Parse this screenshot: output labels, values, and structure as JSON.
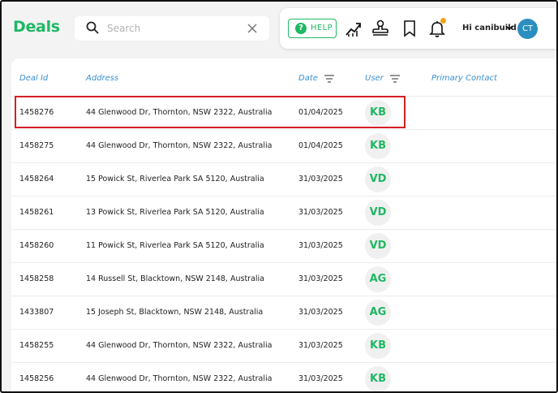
{
  "page_title": "Deals",
  "search": {
    "placeholder": "Search"
  },
  "header": {
    "help_label": "HELP",
    "greeting": "Hi canibuild",
    "avatar_initials": "CT"
  },
  "table": {
    "columns": {
      "deal_id": "Deal Id",
      "address": "Address",
      "date": "Date",
      "user": "User",
      "primary_contact": "Primary Contact"
    },
    "rows": [
      {
        "deal_id": "1458276",
        "address": "44 Glenwood Dr, Thornton, NSW 2322, Australia",
        "date": "01/04/2025",
        "user": "KB"
      },
      {
        "deal_id": "1458275",
        "address": "44 Glenwood Dr, Thornton, NSW 2322, Australia",
        "date": "01/04/2025",
        "user": "KB"
      },
      {
        "deal_id": "1458264",
        "address": "15 Powick St, Riverlea Park SA 5120, Australia",
        "date": "31/03/2025",
        "user": "VD"
      },
      {
        "deal_id": "1458261",
        "address": "13 Powick St, Riverlea Park SA 5120, Australia",
        "date": "31/03/2025",
        "user": "VD"
      },
      {
        "deal_id": "1458260",
        "address": "11 Powick St, Riverlea Park SA 5120, Australia",
        "date": "31/03/2025",
        "user": "VD"
      },
      {
        "deal_id": "1458258",
        "address": "14 Russell St, Blacktown, NSW 2148, Australia",
        "date": "31/03/2025",
        "user": "AG"
      },
      {
        "deal_id": "1433807",
        "address": "15 Joseph St, Blacktown, NSW 2148, Australia",
        "date": "31/03/2025",
        "user": "AG"
      },
      {
        "deal_id": "1458255",
        "address": "44 Glenwood Dr, Thornton, NSW 2322, Australia",
        "date": "31/03/2025",
        "user": "KB"
      },
      {
        "deal_id": "1458256",
        "address": "44 Glenwood Dr, Thornton, NSW 2322, Australia",
        "date": "31/03/2025",
        "user": "KB"
      }
    ]
  },
  "colors": {
    "brand_green": "#1fb864",
    "header_blue": "#3a8fd0",
    "highlight_red": "#d41f26",
    "notification": "#f3a21a"
  },
  "icons": [
    "search-icon",
    "clear-icon",
    "help-icon",
    "analytics-icon",
    "stamp-icon",
    "bookmark-icon",
    "bell-icon",
    "chevron-down-icon",
    "filter-icon"
  ]
}
